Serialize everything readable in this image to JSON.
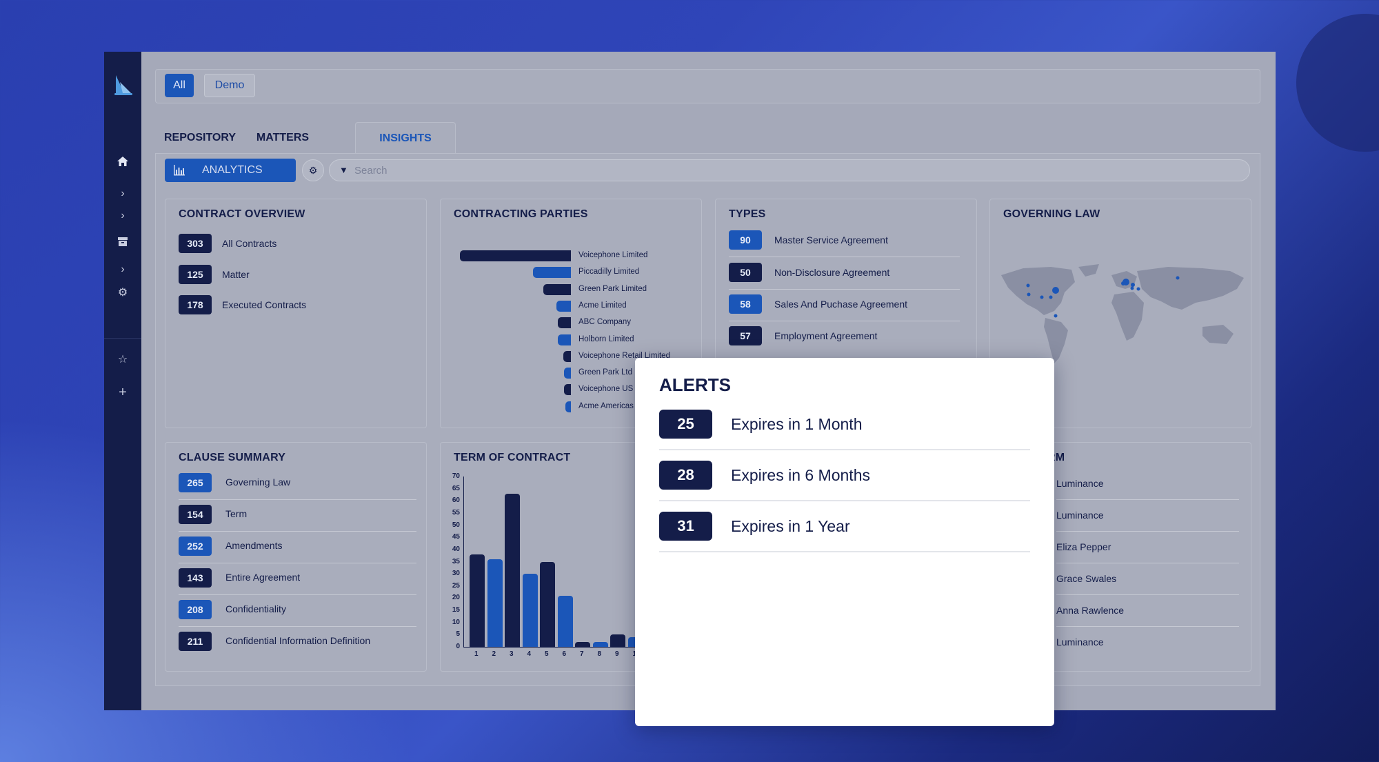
{
  "filters": {
    "all_label": "All",
    "demo_label": "Demo"
  },
  "tabs": [
    {
      "label": "REPOSITORY"
    },
    {
      "label": "MATTERS"
    },
    {
      "label": "INSIGHTS"
    }
  ],
  "toolbar": {
    "analytics_label": "ANALYTICS",
    "search_placeholder": "Search"
  },
  "contract_overview": {
    "title": "CONTRACT OVERVIEW",
    "rows": [
      {
        "count": "303",
        "label": "All Contracts"
      },
      {
        "count": "125",
        "label": "Matter"
      },
      {
        "count": "178",
        "label": "Executed Contracts"
      }
    ]
  },
  "contracting_parties": {
    "title": "CONTRACTING PARTIES",
    "items": [
      {
        "label": "Voicephone Limited",
        "value": 100,
        "color": "dark"
      },
      {
        "label": "Piccadilly Limited",
        "value": 34,
        "color": "blue"
      },
      {
        "label": "Green Park Limited",
        "value": 25,
        "color": "dark"
      },
      {
        "label": "Acme Limited",
        "value": 13,
        "color": "blue"
      },
      {
        "label": "ABC Company",
        "value": 12,
        "color": "dark"
      },
      {
        "label": "Holborn Limited",
        "value": 12,
        "color": "blue"
      },
      {
        "label": "Voicephone Retail Limited",
        "value": 7,
        "color": "dark"
      },
      {
        "label": "Green Park Ltd",
        "value": 6,
        "color": "blue"
      },
      {
        "label": "Voicephone US",
        "value": 6,
        "color": "dark"
      },
      {
        "label": "Acme Americas",
        "value": 5,
        "color": "blue"
      }
    ]
  },
  "types": {
    "title": "TYPES",
    "rows": [
      {
        "count": "90",
        "label": "Master Service Agreement",
        "color": "blue"
      },
      {
        "count": "50",
        "label": "Non-Disclosure Agreement",
        "color": "dark"
      },
      {
        "count": "58",
        "label": "Sales And Puchase Agreement",
        "color": "blue"
      },
      {
        "count": "57",
        "label": "Employment Agreement",
        "color": "dark"
      }
    ]
  },
  "governing_law": {
    "title": "GOVERNING LAW"
  },
  "clause_summary": {
    "title": "CLAUSE SUMMARY",
    "rows": [
      {
        "count": "265",
        "label": "Governing Law",
        "color": "blue"
      },
      {
        "count": "154",
        "label": "Term",
        "color": "dark"
      },
      {
        "count": "252",
        "label": "Amendments",
        "color": "blue"
      },
      {
        "count": "143",
        "label": "Entire Agreement",
        "color": "dark"
      },
      {
        "count": "208",
        "label": "Confidentiality",
        "color": "blue"
      },
      {
        "count": "211",
        "label": "Confidential Information Definition",
        "color": "dark"
      }
    ]
  },
  "term_of_contract": {
    "title": "TERM OF CONTRACT"
  },
  "platform": {
    "title": "PLATFORM",
    "rows": [
      {
        "label": "Luminance"
      },
      {
        "label": "Luminance"
      },
      {
        "label": "Eliza Pepper"
      },
      {
        "label": "Grace Swales"
      },
      {
        "label": "Anna Rawlence"
      },
      {
        "label": "Luminance"
      }
    ]
  },
  "alerts": {
    "title": "ALERTS",
    "rows": [
      {
        "count": "25",
        "label": "Expires in 1 Month"
      },
      {
        "count": "28",
        "label": "Expires in 6 Months"
      },
      {
        "count": "31",
        "label": "Expires in 1 Year"
      }
    ]
  },
  "chart_data": {
    "type": "bar",
    "title": "TERM OF CONTRACT",
    "categories": [
      "1",
      "2",
      "3",
      "4",
      "5",
      "6",
      "7",
      "8",
      "9",
      "1"
    ],
    "values": [
      38,
      36,
      63,
      30,
      35,
      21,
      2,
      2,
      5,
      4
    ],
    "colors": [
      "dark",
      "blue",
      "dark",
      "blue",
      "dark",
      "blue",
      "dark",
      "blue",
      "dark",
      "blue"
    ],
    "yticks": [
      "0",
      "5",
      "10",
      "15",
      "20",
      "25",
      "30",
      "35",
      "40",
      "45",
      "50",
      "55",
      "60",
      "65",
      "70"
    ],
    "ylim": [
      0,
      70
    ]
  }
}
